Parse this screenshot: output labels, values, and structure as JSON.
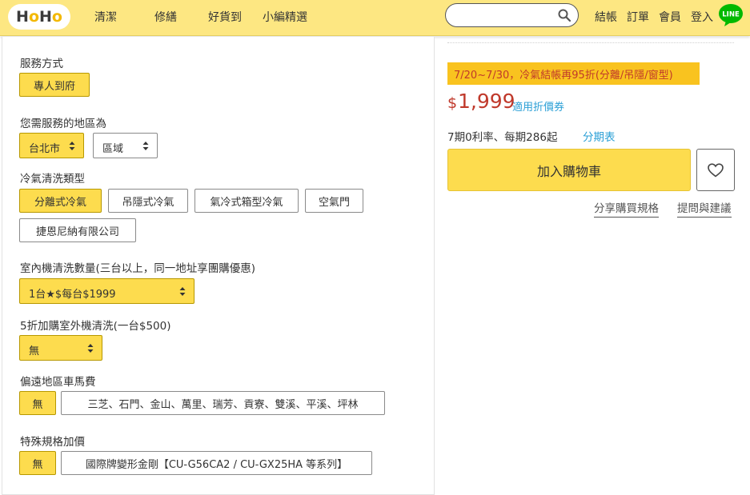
{
  "header": {
    "logo": {
      "h1": "H",
      "o1": "o",
      "h2": "H",
      "o2": "o"
    },
    "nav": [
      "清潔",
      "修繕",
      "好貨到",
      "小編精選"
    ],
    "search_value": "",
    "links": [
      "結帳",
      "訂單",
      "會員",
      "登入"
    ],
    "line_badge": "LINE",
    "brand_color": "#fde782"
  },
  "form": {
    "service_method": {
      "label": "服務方式",
      "options": [
        "專人到府"
      ],
      "selected": 0
    },
    "region": {
      "label": "您需服務的地區為",
      "city": "台北市",
      "district": "區域"
    },
    "ac_type": {
      "label": "冷氣清洗類型",
      "options": [
        "分離式冷氣",
        "吊隱式冷氣",
        "氣冷式箱型冷氣",
        "空氣門",
        "捷恩尼納有限公司"
      ],
      "selected": 0
    },
    "indoor_qty": {
      "label": "室內機清洗數量(三台以上，同一地址享團購優惠)",
      "value": "1台★$每台$1999"
    },
    "outdoor": {
      "label": "5折加購室外機清洗(一台$500)",
      "value": "無"
    },
    "remote_fee": {
      "label": "偏遠地區車馬費",
      "options": [
        "無",
        "三芝、石門、金山、萬里、瑞芳、貢寮、雙溪、平溪、坪林"
      ],
      "selected": 0
    },
    "special_spec": {
      "label": "特殊規格加價",
      "options": [
        "無",
        "國際牌變形金剛【CU-G56CA2 / CU-GX25HA 等系列】"
      ],
      "selected": 0
    }
  },
  "product": {
    "promo": "7/20~7/30，冷氣結帳再95折(分離/吊隱/窗型)",
    "currency": "$",
    "price": "1,999",
    "coupon": "適用折價券",
    "installment": "7期0利率、每期286起",
    "installment_link": "分期表",
    "cart_label": "加入購物車",
    "share_link": "分享購買規格",
    "ask_link": "提問與建議",
    "accent_color": "#c0392b",
    "highlight_color": "#fddc4e"
  }
}
